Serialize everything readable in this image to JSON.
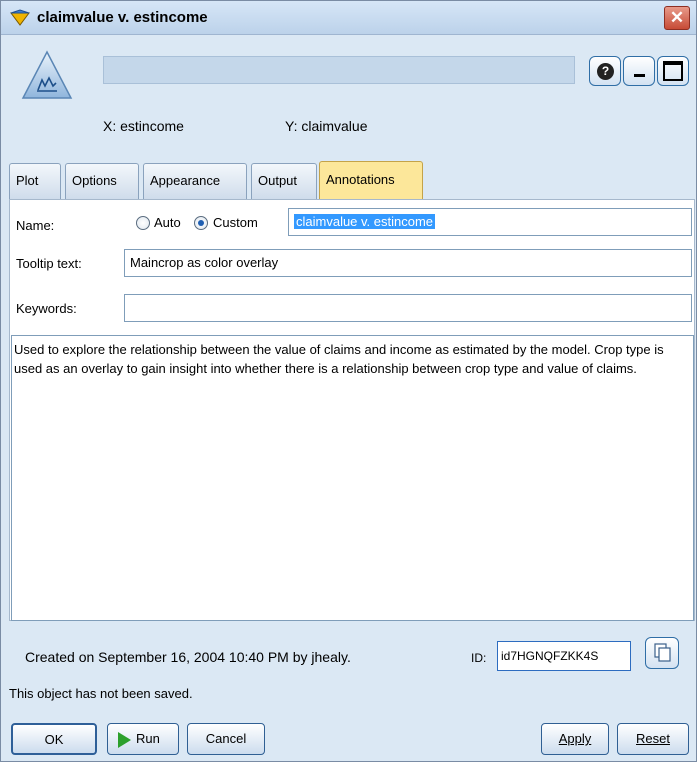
{
  "window": {
    "title": "claimvalue  v. estincome",
    "colors": {
      "accent_tab": "#fce79a",
      "selection": "#3399ff",
      "close": "#c74b36"
    }
  },
  "header": {
    "x_axis": "X: estincome",
    "y_axis": "Y: claimvalue",
    "help_symbol": "?",
    "icons": [
      "plot-node-icon",
      "help-icon",
      "minimize-icon",
      "maximize-icon"
    ]
  },
  "tabs": [
    {
      "label": "Plot",
      "active": false
    },
    {
      "label": "Options",
      "active": false
    },
    {
      "label": "Appearance",
      "active": false
    },
    {
      "label": "Output",
      "active": false
    },
    {
      "label": "Annotations",
      "active": true
    }
  ],
  "form": {
    "name_label": "Name:",
    "radio_auto_label": "Auto",
    "radio_custom_label": "Custom",
    "selected_radio": "Custom",
    "name_value": "claimvalue  v. estincome",
    "tooltip_label": "Tooltip text:",
    "tooltip_value": "Maincrop as color overlay",
    "keywords_label": "Keywords:",
    "keywords_value": "",
    "description": "Used to explore the relationship between the value of claims and income as estimated by the model. Crop type is used as an overlay to gain insight into whether there is a relationship between crop type and value of claims."
  },
  "footer": {
    "created": "Created on September 16, 2004 10:40 PM by jhealy.",
    "id_label": "ID:",
    "id_value": "id7HGNQFZKK4S",
    "status": "This object has not been saved."
  },
  "buttons": {
    "ok": "OK",
    "run": "Run",
    "cancel": "Cancel",
    "apply": "Apply",
    "reset": "Reset",
    "close_symbol": "✕"
  }
}
